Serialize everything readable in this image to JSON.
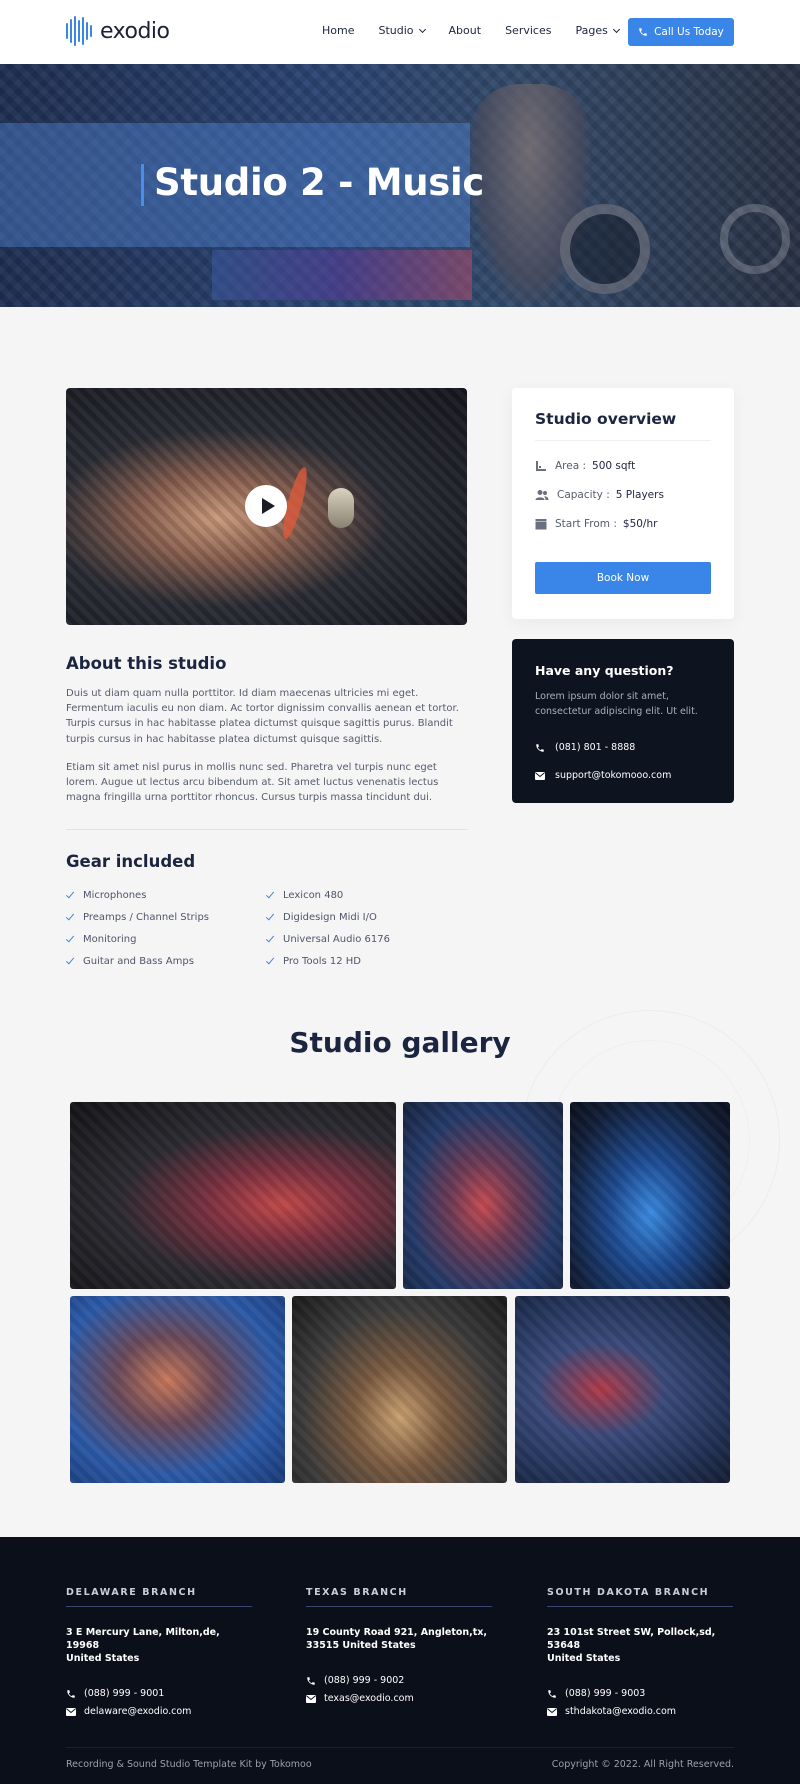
{
  "brand": {
    "name": "exodio",
    "accent": "#3a86e8"
  },
  "nav": {
    "items": [
      {
        "label": "Home",
        "dropdown": false
      },
      {
        "label": "Studio",
        "dropdown": true
      },
      {
        "label": "About",
        "dropdown": false
      },
      {
        "label": "Services",
        "dropdown": false
      },
      {
        "label": "Pages",
        "dropdown": true
      }
    ],
    "cta": "Call Us Today"
  },
  "hero": {
    "title": "Studio 2 - Music"
  },
  "about": {
    "title": "About this studio",
    "paragraphs": [
      "Duis ut diam quam nulla porttitor. Id diam maecenas ultricies mi eget. Fermentum iaculis eu non diam. Ac tortor dignissim convallis aenean et tortor. Turpis cursus in hac habitasse platea dictumst quisque sagittis purus. Blandit turpis cursus in hac habitasse platea dictumst quisque sagittis.",
      "Etiam sit amet nisl purus in mollis nunc sed. Pharetra vel turpis nunc eget lorem. Augue ut lectus arcu bibendum at. Sit amet luctus venenatis lectus magna fringilla urna porttitor rhoncus. Cursus turpis massa tincidunt dui."
    ]
  },
  "gear": {
    "title": "Gear included",
    "left": [
      "Microphones",
      "Preamps / Channel Strips",
      "Monitoring",
      "Guitar and Bass Amps"
    ],
    "right": [
      "Lexicon 480",
      "Digidesign Midi I/O",
      "Universal Audio 6176",
      "Pro Tools 12 HD"
    ]
  },
  "overview": {
    "title": "Studio overview",
    "rows": [
      {
        "icon": "area-icon",
        "label": "Area :",
        "value": "500 sqft"
      },
      {
        "icon": "users-icon",
        "label": "Capacity :",
        "value": "5 Players"
      },
      {
        "icon": "clapper-icon",
        "label": "Start From :",
        "value": "$50/hr"
      }
    ],
    "button": "Book Now"
  },
  "question": {
    "title": "Have any question?",
    "text": "Lorem ipsum dolor sit amet, consectetur adipiscing elit. Ut elit.",
    "phone": "(081) 801 - 8888",
    "email": "support@tokomooo.com"
  },
  "gallery": {
    "title": "Studio gallery"
  },
  "footer": {
    "branches": [
      {
        "title": "DELAWARE BRANCH",
        "address1": "3 E Mercury Lane, Milton,de, 19968",
        "address2": "United States",
        "phone": "(088) 999 - 9001",
        "email": "delaware@exodio.com"
      },
      {
        "title": "TEXAS BRANCH",
        "address1": "19 County Road 921, Angleton,tx,",
        "address2": "33515 United States",
        "phone": "(088) 999 - 9002",
        "email": "texas@exodio.com"
      },
      {
        "title": "SOUTH DAKOTA BRANCH",
        "address1": "23 101st Street SW, Pollock,sd, 53648",
        "address2": "United States",
        "phone": "(088) 999 - 9003",
        "email": "sthdakota@exodio.com"
      }
    ],
    "credit": "Recording & Sound Studio Template Kit by Tokomoo",
    "copyright": "Copyright © 2022. All Right Reserved."
  }
}
